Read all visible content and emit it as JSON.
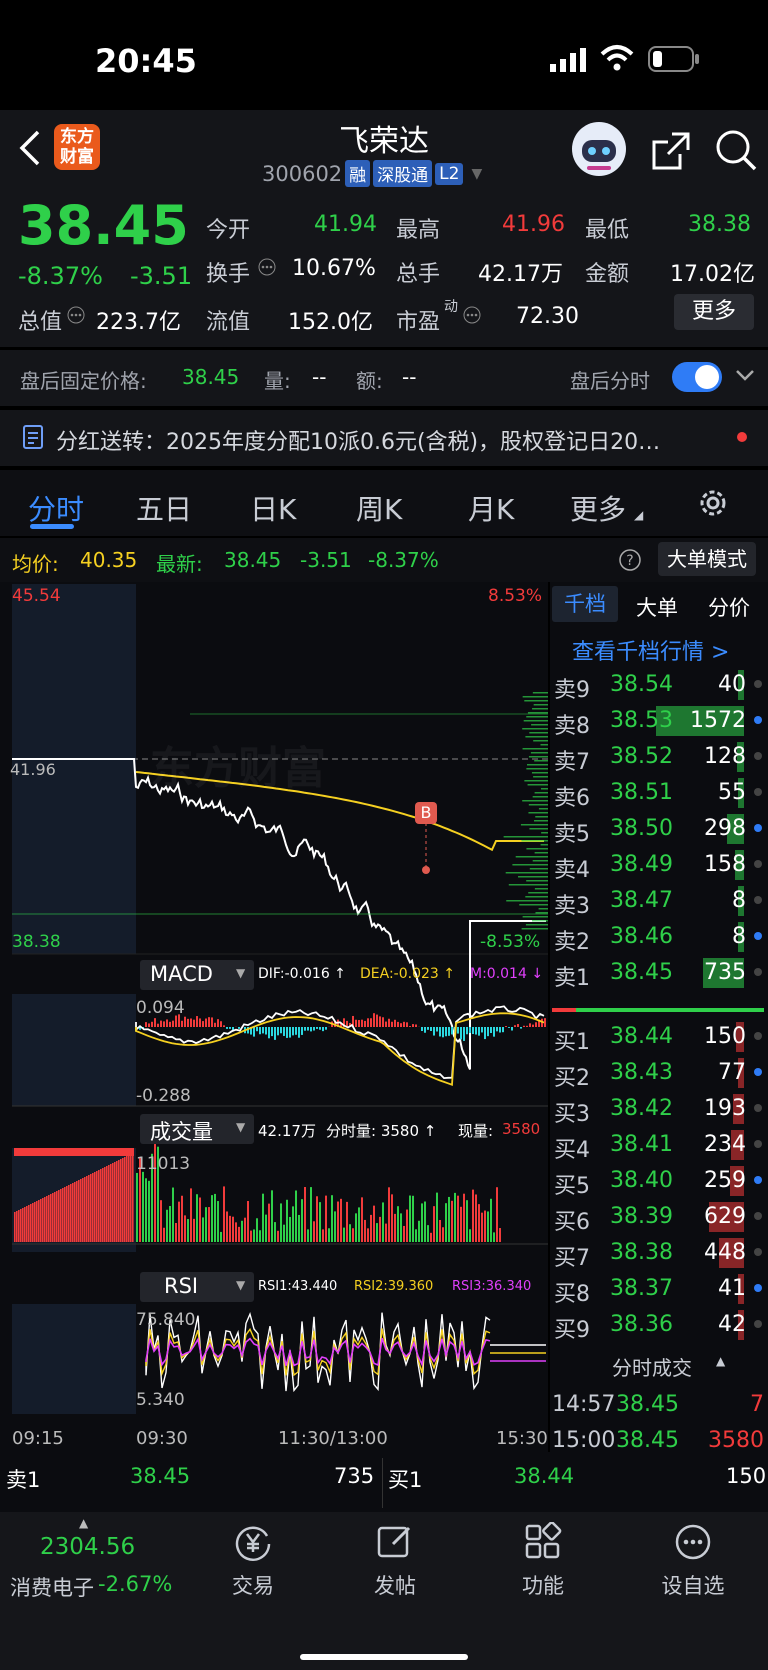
{
  "status": {
    "time": "20:45"
  },
  "header": {
    "logo": "东方\n财富",
    "name": "飞荣达",
    "code": "300602",
    "tags": [
      "融",
      "深股通",
      "L2"
    ]
  },
  "quote": {
    "price": "38.45",
    "change_pct": "-8.37%",
    "change": "-3.51",
    "open_label": "今开",
    "open": "41.94",
    "high_label": "最高",
    "high": "41.96",
    "low_label": "最低",
    "low": "38.38",
    "turnover_label": "换手",
    "turnover": "10.67%",
    "volume_label": "总手",
    "volume": "42.17万",
    "amount_label": "金额",
    "amount": "17.02亿",
    "mktcap_label": "总值",
    "mktcap": "223.7亿",
    "float_label": "流值",
    "float": "152.0亿",
    "pe_label": "市盈",
    "pe_sup": "动",
    "pe": "72.30",
    "more": "更多"
  },
  "after_hours": {
    "label": "盘后固定价格:",
    "price": "38.45",
    "vol_label": "量:",
    "vol": "--",
    "amt_label": "额:",
    "amt": "--",
    "toggle_label": "盘后分时"
  },
  "notice": {
    "text": "分红送转：2025年度分配10派0.6元(含税)，股权登记日20…"
  },
  "tabs": [
    "分时",
    "五日",
    "日K",
    "周K",
    "月K",
    "更多"
  ],
  "avg": {
    "avg_label": "均价:",
    "avg": "40.35",
    "latest_label": "最新:",
    "latest": "38.45",
    "chg": "-3.51",
    "pct": "-8.37%",
    "mode": "大单模式"
  },
  "price_chart": {
    "high": "45.54",
    "low": "38.38",
    "high_pct": "8.53%",
    "low_pct": "-8.53%",
    "prev_close": "41.96",
    "watermark": "东方财富",
    "marker": "B"
  },
  "macd": {
    "name": "MACD",
    "dif": "DIF:-0.016 ↑",
    "dea": "DEA:-0.023 ↑",
    "m": "M:0.014 ↓",
    "max": "0.094",
    "min": "-0.288"
  },
  "vol": {
    "name": "成交量",
    "total": "42.17万",
    "tick": "分时量: 3580 ↑",
    "now_label": "现量:",
    "now": "3580",
    "max": "11013"
  },
  "rsi": {
    "name": "RSI",
    "r1": "RSI1:43.440",
    "r2": "RSI2:39.360",
    "r3": "RSI3:36.340",
    "max": "75.840",
    "min": "5.340"
  },
  "time_axis": [
    "09:15",
    "09:30",
    "11:30/13:00",
    "15:30"
  ],
  "book": {
    "tabs": [
      "千档",
      "大单",
      "分价"
    ],
    "link": "查看千档行情 >",
    "asks": [
      {
        "l": "卖9",
        "p": "38.54",
        "v": "40"
      },
      {
        "l": "卖8",
        "p": "38.53",
        "v": "1572"
      },
      {
        "l": "卖7",
        "p": "38.52",
        "v": "128"
      },
      {
        "l": "卖6",
        "p": "38.51",
        "v": "55"
      },
      {
        "l": "卖5",
        "p": "38.50",
        "v": "298"
      },
      {
        "l": "卖4",
        "p": "38.49",
        "v": "158"
      },
      {
        "l": "卖3",
        "p": "38.47",
        "v": "8"
      },
      {
        "l": "卖2",
        "p": "38.46",
        "v": "8"
      },
      {
        "l": "卖1",
        "p": "38.45",
        "v": "735"
      }
    ],
    "bids": [
      {
        "l": "买1",
        "p": "38.44",
        "v": "150"
      },
      {
        "l": "买2",
        "p": "38.43",
        "v": "77"
      },
      {
        "l": "买3",
        "p": "38.42",
        "v": "193"
      },
      {
        "l": "买4",
        "p": "38.41",
        "v": "234"
      },
      {
        "l": "买5",
        "p": "38.40",
        "v": "259"
      },
      {
        "l": "买6",
        "p": "38.39",
        "v": "629"
      },
      {
        "l": "买7",
        "p": "38.38",
        "v": "448"
      },
      {
        "l": "买8",
        "p": "38.37",
        "v": "41"
      },
      {
        "l": "买9",
        "p": "38.36",
        "v": "42"
      }
    ],
    "trades_label": "分时成交",
    "trades": [
      {
        "t": "14:57",
        "p": "38.45",
        "v": "7"
      },
      {
        "t": "15:00",
        "p": "38.45",
        "v": "3580"
      }
    ]
  },
  "bottom_book": {
    "ask_label": "卖1",
    "ask_p": "38.45",
    "ask_v": "735",
    "bid_label": "买1",
    "bid_p": "38.44",
    "bid_v": "150"
  },
  "tabbar": {
    "index_value": "2304.56",
    "index_name": "消费电子",
    "index_pct": "-2.67%",
    "items": [
      "交易",
      "发帖",
      "功能",
      "设自选"
    ]
  },
  "colors": {
    "up": "#f23b3b",
    "down": "#2fd04a",
    "accent": "#2f7cf6",
    "avg": "#f5d021"
  }
}
